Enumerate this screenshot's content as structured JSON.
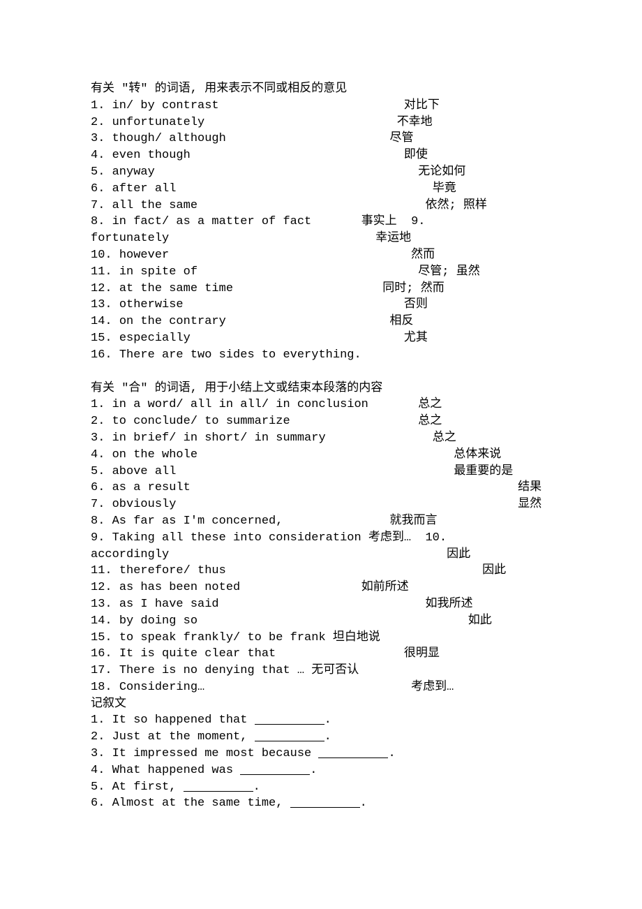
{
  "section1": {
    "title": "有关 \"转\" 的词语, 用来表示不同或相反的意见",
    "items": [
      {
        "n": "1.",
        "term": "in/ by contrast",
        "pad": "                          ",
        "def": "对比下"
      },
      {
        "n": "2.",
        "term": "unfortunately",
        "pad": "                           ",
        "def": "不幸地"
      },
      {
        "n": "3.",
        "term": "though/ although",
        "pad": "                       ",
        "def": "尽管"
      },
      {
        "n": "4.",
        "term": "even though",
        "pad": "                              ",
        "def": "即使"
      },
      {
        "n": "5.",
        "term": "anyway",
        "pad": "                                     ",
        "def": "无论如何"
      },
      {
        "n": "6.",
        "term": "after all",
        "pad": "                                    ",
        "def": "毕竟"
      },
      {
        "n": "7.",
        "term": "all the same",
        "pad": "                                ",
        "def": "依然; 照样"
      },
      {
        "n": "8.",
        "term": "in fact/ as a matter of fact",
        "pad": "       ",
        "def": "事实上  9."
      },
      {
        "n": "",
        "term": "fortunately",
        "pad": "                             ",
        "def": "幸运地"
      },
      {
        "n": "10.",
        "term": "however",
        "pad": "                                  ",
        "def": "然而"
      },
      {
        "n": "11.",
        "term": "in spite of",
        "pad": "                               ",
        "def": "尽管; 虽然"
      },
      {
        "n": "12.",
        "term": "at the same time",
        "pad": "                     ",
        "def": "同时; 然而"
      },
      {
        "n": "13.",
        "term": "otherwise",
        "pad": "                               ",
        "def": "否则"
      },
      {
        "n": "14.",
        "term": "on the contrary",
        "pad": "                       ",
        "def": "相反"
      },
      {
        "n": "15.",
        "term": "especially",
        "pad": "                              ",
        "def": "尤其"
      },
      {
        "n": "16.",
        "term": "There are two sides to everything.",
        "pad": "",
        "def": ""
      }
    ]
  },
  "section2": {
    "title": "有关 \"合\" 的词语, 用于小结上文或结束本段落的内容",
    "items": [
      {
        "n": "1.",
        "term": "in a word/ all in all/ in conclusion",
        "pad": "       ",
        "def": "总之"
      },
      {
        "n": "2.",
        "term": "to conclude/ to summarize",
        "pad": "                  ",
        "def": "总之"
      },
      {
        "n": "3.",
        "term": "in brief/ in short/ in summary",
        "pad": "               ",
        "def": "总之"
      },
      {
        "n": "4.",
        "term": "on the whole",
        "pad": "                                    ",
        "def": "总体来说"
      },
      {
        "n": "5.",
        "term": "above all",
        "pad": "                                       ",
        "def": "最重要的是"
      },
      {
        "n": "6.",
        "term": "as a result",
        "pad": "                                              ",
        "def": "结果"
      },
      {
        "n": "7.",
        "term": "obviously",
        "pad": "                                                ",
        "def": "显然"
      },
      {
        "n": "8.",
        "term": "As far as I'm concerned,",
        "pad": "               ",
        "def": "就我而言"
      },
      {
        "n": "9.",
        "term": "Taking all these into consideration",
        "pad": " ",
        "def": "考虑到…  10."
      },
      {
        "n": "",
        "term": "accordingly",
        "pad": "                                       ",
        "def": "因此"
      },
      {
        "n": "11.",
        "term": "therefore/ thus",
        "pad": "                                    ",
        "def": "因此"
      },
      {
        "n": "12.",
        "term": "as has been noted",
        "pad": "                 ",
        "def": "如前所述"
      },
      {
        "n": "13.",
        "term": "as I have said",
        "pad": "                             ",
        "def": "如我所述"
      },
      {
        "n": "14.",
        "term": "by doing so",
        "pad": "                                      ",
        "def": "如此"
      },
      {
        "n": "15.",
        "term": "to speak frankly/ to be frank",
        "pad": " ",
        "def": "坦白地说"
      },
      {
        "n": "16.",
        "term": "It is quite clear that",
        "pad": "                  ",
        "def": "很明显"
      },
      {
        "n": "17.",
        "term": "There is no denying that …",
        "pad": " ",
        "def": "无可否认"
      },
      {
        "n": "18.",
        "term": "Considering…",
        "pad": "                             ",
        "def": "考虑到…"
      }
    ]
  },
  "narrative": {
    "title": "记叙文",
    "items": [
      {
        "n": "1.",
        "pre": "It so happened that ",
        "post": "."
      },
      {
        "n": "2.",
        "pre": "Just at the moment, ",
        "post": "."
      },
      {
        "n": "3.",
        "pre": "It impressed me most because ",
        "post": "."
      },
      {
        "n": "4.",
        "pre": "What happened was ",
        "post": "."
      },
      {
        "n": "5.",
        "pre": "At first, ",
        "post": "."
      },
      {
        "n": "6.",
        "pre": "Almost at the same time, ",
        "post": "."
      }
    ]
  }
}
